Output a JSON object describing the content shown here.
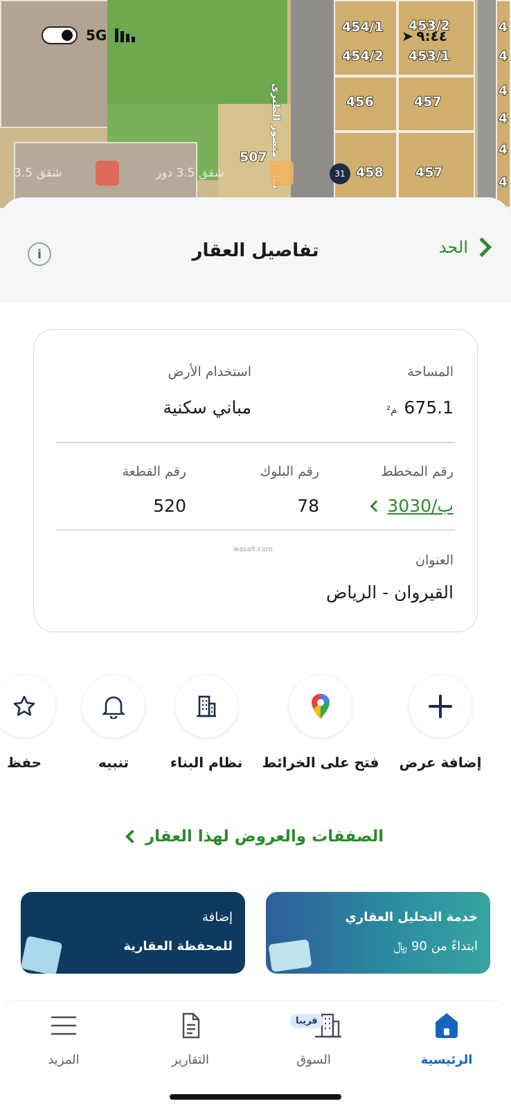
{
  "status_bar": {
    "network": "5G",
    "time": "٩:٤٤"
  },
  "map": {
    "street_name": "شارع منصور الطبري",
    "parcels": [
      "454/1",
      "453/2",
      "454/2",
      "453/1",
      "456",
      "457",
      "458",
      "507",
      "457",
      "4",
      "4",
      "4",
      "4",
      "4",
      "4"
    ],
    "faint_labels": [
      "شقق 3.5",
      "شقق 3.5 دور"
    ],
    "badge": "31"
  },
  "header": {
    "title": "تفاصيل العقار",
    "back_label": "الحد"
  },
  "details": {
    "area_label": "المساحة",
    "area_value": "675.1",
    "area_unit": "م²",
    "land_use_label": "استخدام الأرض",
    "land_use_value": "مباني سكنية",
    "plan_label": "رقم المخطط",
    "plan_value": "3030/ب",
    "block_label": "رقم البلوك",
    "block_value": "78",
    "plot_label": "رقم القطعة",
    "plot_value": "520",
    "address_label": "العنوان",
    "address_value": "القيروان - الرياض",
    "watermark": "wasalt.com"
  },
  "actions": [
    {
      "label": "إضافة عرض",
      "icon": "plus-icon"
    },
    {
      "label": "فتح على الخرائط",
      "icon": "map-pin-icon"
    },
    {
      "label": "نظام البناء",
      "icon": "building-icon"
    },
    {
      "label": "تنبيه",
      "icon": "bell-icon"
    },
    {
      "label": "حفظ",
      "icon": "star-icon"
    }
  ],
  "deals_link": "الصفقات والعروض لهذا العقار",
  "promos": {
    "analysis": {
      "title": "خدمة التحليل العقاري",
      "subtitle": "ابتداءً من 90 ﷼"
    },
    "portfolio": {
      "title": "إضافة",
      "subtitle": "للمحفظة العقارية"
    }
  },
  "tabbar": {
    "home": "الرئيسية",
    "market": "السوق",
    "market_badge": "قريبا",
    "reports": "التقارير",
    "more": "المزيد"
  },
  "colors": {
    "accent_green": "#2c8a2c",
    "active_blue": "#1565c0",
    "navy": "#0d3a5e"
  }
}
